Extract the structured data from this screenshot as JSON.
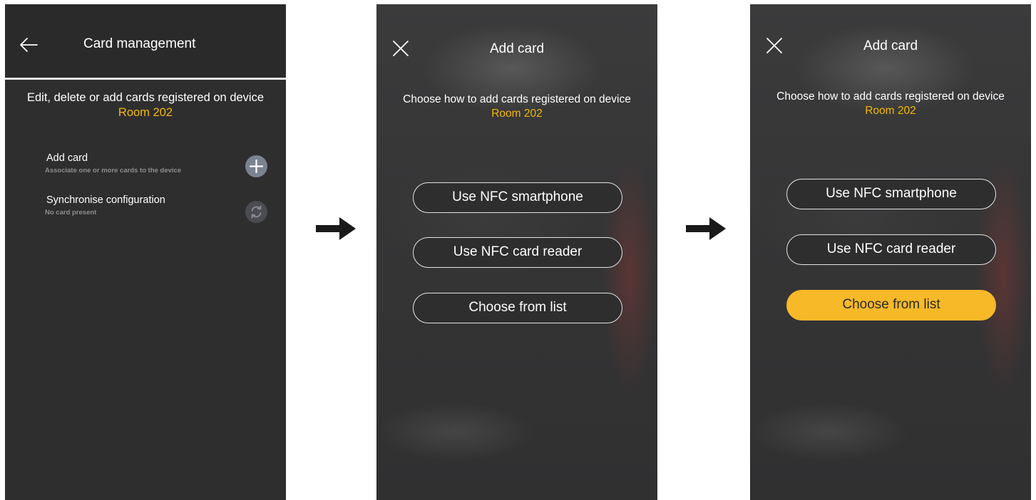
{
  "screens": [
    {
      "title": "Card management",
      "description_text": "Edit, delete or add cards registered on device",
      "device_name": "Room 202",
      "items": [
        {
          "title": "Add card",
          "subtitle": "Associate one or more cards to the device",
          "icon": "plus-icon"
        },
        {
          "title": "Synchronise configuration",
          "subtitle": "No card present",
          "icon": "sync-icon"
        }
      ]
    },
    {
      "title": "Add card",
      "description_text": "Choose how to add cards registered on device",
      "device_name": "Room 202",
      "options": [
        "Use NFC smartphone",
        "Use NFC card reader",
        "Choose from list"
      ],
      "selected_option": ""
    },
    {
      "title": "Add card",
      "description_text": "Choose how to add cards registered on device",
      "device_name": "Room 202",
      "options": [
        "Use NFC smartphone",
        "Use NFC card reader",
        "Choose from list"
      ],
      "selected_option": "Choose from list"
    }
  ],
  "colors": {
    "accent": "#f5b800",
    "selected_button": "#f7b928",
    "screen_background": "#2e2e2f",
    "arrow": "#1a1a1a"
  }
}
